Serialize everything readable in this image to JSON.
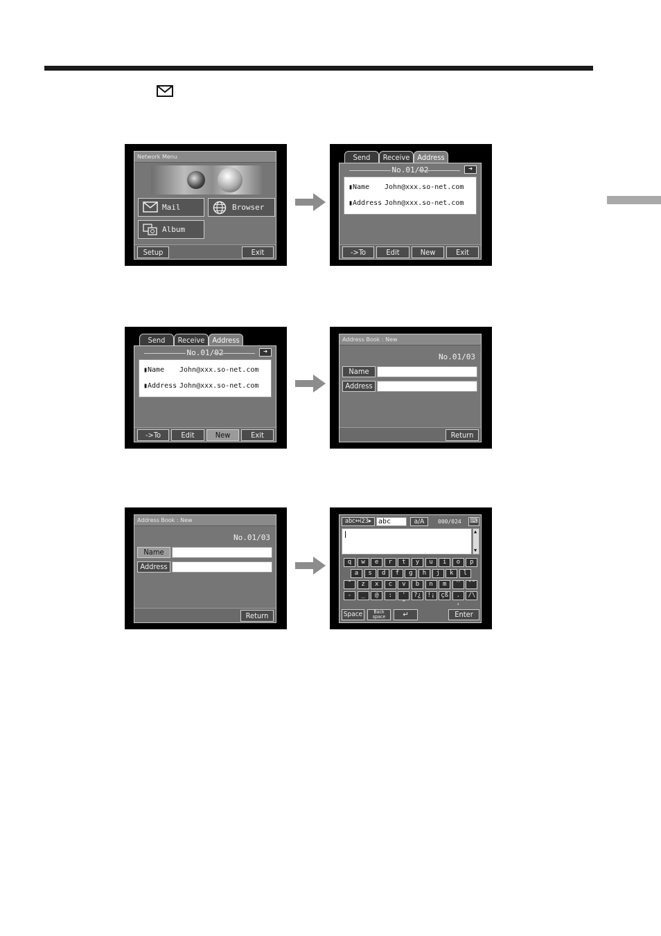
{
  "screen1": {
    "title": "Network Menu",
    "mail_label": "Mail",
    "browser_label": "Browser",
    "album_label": "Album",
    "setup_label": "Setup",
    "exit_label": "Exit"
  },
  "address_screen": {
    "tabs": [
      "Send",
      "Receive",
      "Address"
    ],
    "record_no": "No.01/02",
    "name_label": "▮Name",
    "name_value": "John@xxx.so-net.com",
    "address_label": "▮Address",
    "address_value": "John@xxx.so-net.com",
    "buttons": [
      "->To",
      "Edit",
      "New",
      "Exit"
    ]
  },
  "new_entry_screen": {
    "title": "Address Book : New",
    "record_no": "No.01/03",
    "name_label": "Name",
    "address_label": "Address",
    "return_label": "Return"
  },
  "keyboard_screen": {
    "mode_label": "abc↔i23▸",
    "mode_value": "abc",
    "case_label": "a/A",
    "counter": "000/024",
    "rows": [
      [
        "q",
        "w",
        "e",
        "r",
        "t",
        "y",
        "u",
        "i",
        "o",
        "p"
      ],
      [
        "a",
        "s",
        "d",
        "f",
        "g",
        "h",
        "j",
        "k",
        "l"
      ],
      [
        "˜",
        "z",
        "x",
        "c",
        "v",
        "b",
        "n",
        "m",
        "ˋˊ",
        "ˆ˜"
      ],
      [
        "-",
        "_",
        "@",
        ":",
        "' \"",
        "?¿",
        "!¡",
        "çß",
        ". ,",
        "/\\"
      ]
    ],
    "space_label": "Space",
    "backspace_label": "Back space",
    "enter_label": "Enter"
  }
}
